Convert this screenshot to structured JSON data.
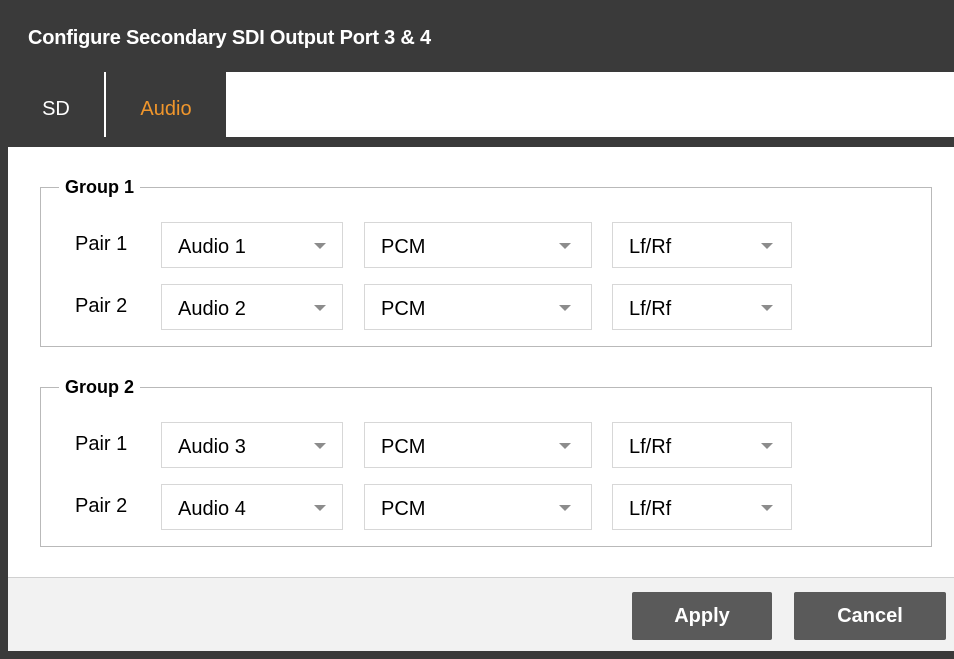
{
  "dialog": {
    "title": "Configure Secondary SDI Output Port 3 & 4"
  },
  "tabs": [
    {
      "label": "SD",
      "active": false
    },
    {
      "label": "Audio",
      "active": true
    }
  ],
  "colors": {
    "chrome": "#3a3a3a",
    "active_tab": "#f0962c",
    "button": "#5a5a5a"
  },
  "groups": [
    {
      "legend": "Group 1",
      "pairs": [
        {
          "label": "Pair 1",
          "source": "Audio 1",
          "format": "PCM",
          "channels": "Lf/Rf"
        },
        {
          "label": "Pair 2",
          "source": "Audio 2",
          "format": "PCM",
          "channels": "Lf/Rf"
        }
      ]
    },
    {
      "legend": "Group 2",
      "pairs": [
        {
          "label": "Pair 1",
          "source": "Audio 3",
          "format": "PCM",
          "channels": "Lf/Rf"
        },
        {
          "label": "Pair 2",
          "source": "Audio 4",
          "format": "PCM",
          "channels": "Lf/Rf"
        }
      ]
    }
  ],
  "footer": {
    "apply_label": "Apply",
    "cancel_label": "Cancel"
  },
  "icons": {
    "dropdown": "chevron-down-icon"
  }
}
